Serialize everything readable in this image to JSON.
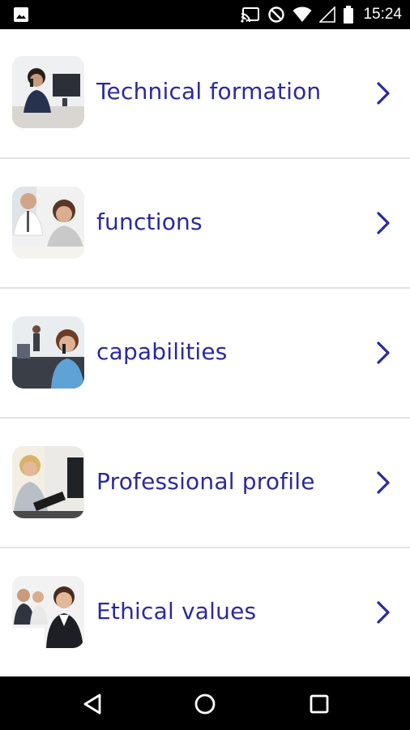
{
  "status_bar": {
    "time": "15:24",
    "icons": [
      "image-icon",
      "cast-icon",
      "do-not-disturb-icon",
      "wifi-icon",
      "signal-icon",
      "battery-icon"
    ]
  },
  "menu": {
    "items": [
      {
        "label": "Technical formation",
        "thumbnail": "woman-on-phone-at-office-desk"
      },
      {
        "label": "functions",
        "thumbnail": "colleagues-reviewing-documents"
      },
      {
        "label": "capabilities",
        "thumbnail": "woman-on-phone-in-office"
      },
      {
        "label": "Professional profile",
        "thumbnail": "woman-with-folder-at-computer"
      },
      {
        "label": "Ethical values",
        "thumbnail": "businesswoman-with-team"
      }
    ]
  },
  "nav_bar": {
    "buttons": [
      "back-icon",
      "home-icon",
      "recents-icon"
    ]
  },
  "colors": {
    "accent": "#2b2a9a",
    "divider": "#e4e4e4",
    "status_bar_bg": "#000000",
    "nav_bar_bg": "#000000"
  }
}
